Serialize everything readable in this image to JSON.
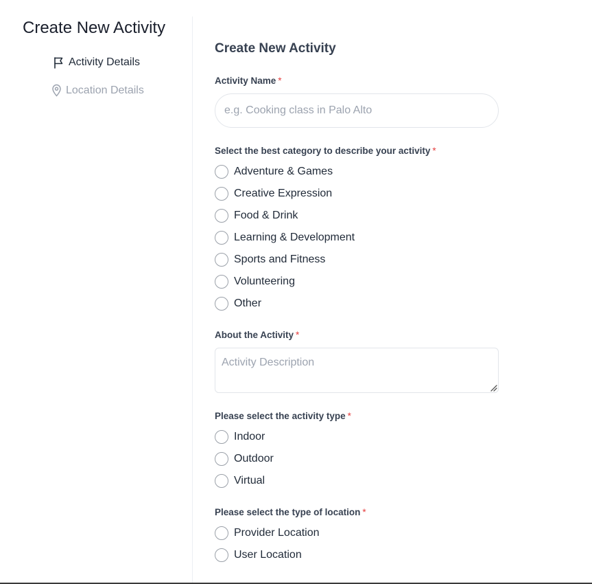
{
  "sidebar": {
    "title": "Create New Activity",
    "steps": [
      {
        "label": "Activity Details",
        "icon": "flag-icon",
        "state": "active"
      },
      {
        "label": "Location Details",
        "icon": "map-pin-icon",
        "state": "inactive"
      }
    ]
  },
  "form": {
    "title": "Create New Activity",
    "required_marker": "*",
    "activity_name": {
      "label": "Activity Name",
      "placeholder": "e.g. Cooking class in Palo Alto",
      "value": ""
    },
    "category": {
      "label": "Select the best category to describe your activity",
      "options": [
        "Adventure & Games",
        "Creative Expression",
        "Food & Drink",
        "Learning & Development",
        "Sports and Fitness",
        "Volunteering",
        "Other"
      ]
    },
    "about": {
      "label": "About the Activity",
      "placeholder": "Activity Description",
      "value": ""
    },
    "activity_type": {
      "label": "Please select the activity type",
      "options": [
        "Indoor",
        "Outdoor",
        "Virtual"
      ]
    },
    "location_type": {
      "label": "Please select the type of location",
      "options": [
        "Provider Location",
        "User Location"
      ]
    }
  },
  "colors": {
    "required": "#e53e3e",
    "text": "#1f2937",
    "muted": "#9ca3af",
    "border": "#e2e5ea"
  }
}
